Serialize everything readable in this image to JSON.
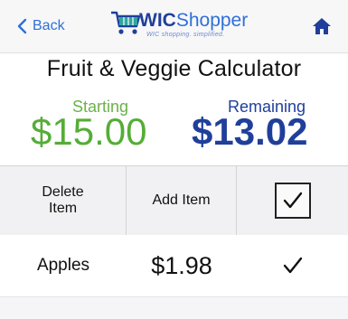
{
  "nav": {
    "back_label": "Back",
    "brand_prefix": "WIC",
    "brand_suffix": "Shopper",
    "tagline": "WIC shopping. simplified."
  },
  "page": {
    "title": "Fruit & Veggie Calculator"
  },
  "balance": {
    "starting_label": "Starting",
    "starting_value": "$15.00",
    "remaining_label": "Remaining",
    "remaining_value": "$13.02"
  },
  "table": {
    "columns": [
      "Delete Item",
      "Add Item"
    ],
    "header_checked": true,
    "rows": [
      {
        "name": "Apples",
        "price": "$1.98",
        "checked": true
      }
    ]
  },
  "colors": {
    "accent_blue": "#1f3f9a",
    "link_blue": "#2f6fd8",
    "starting_green": "#55ad36"
  },
  "icons": [
    "back-chevron-icon",
    "shopping-cart-icon",
    "home-icon",
    "checkmark-icon"
  ]
}
